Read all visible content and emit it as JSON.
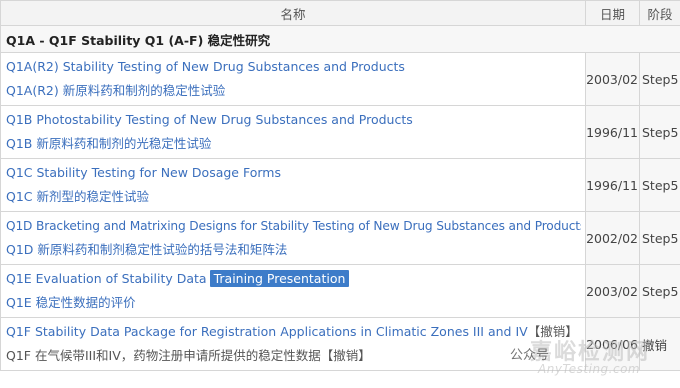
{
  "header": {
    "name": "名称",
    "date": "日期",
    "stage": "阶段"
  },
  "section": {
    "title": "Q1A - Q1F Stability Q1 (A-F) 稳定性研究"
  },
  "items": [
    {
      "en": "Q1A(R2) Stability Testing of New Drug Substances and Products",
      "zh": "Q1A(R2) 新原料药和制剂的稳定性试验",
      "date": "2003/02",
      "stage": "Step5"
    },
    {
      "en": "Q1B Photostability Testing of New Drug Substances and Products",
      "zh": "Q1B 新原料药和制剂的光稳定性试验",
      "date": "1996/11",
      "stage": "Step5"
    },
    {
      "en": "Q1C Stability Testing for New Dosage Forms",
      "zh": "Q1C 新剂型的稳定性试验",
      "date": "1996/11",
      "stage": "Step5"
    },
    {
      "en": "Q1D Bracketing and Matrixing Designs for Stability Testing of New Drug Substances and Products",
      "zh": "Q1D 新原料药和制剂稳定性试验的括号法和矩阵法",
      "date": "2002/02",
      "stage": "Step5"
    },
    {
      "en": "Q1E Evaluation of Stability Data",
      "badge": "Training Presentation",
      "zh": "Q1E 稳定性数据的评价",
      "date": "2003/02",
      "stage": "Step5"
    },
    {
      "en": "Q1F Stability Data Package for Registration Applications in Climatic Zones III and IV",
      "en_suffix": "【撤销】",
      "zh": "Q1F 在气候带III和IV，药物注册申请所提供的稳定性数据",
      "zh_suffix": "【撤销】",
      "date": "2006/06",
      "stage": "撤销"
    }
  ],
  "watermark": {
    "main": "嘉峪检测网",
    "sub": "AnyTesting.com",
    "logo": "公众号"
  }
}
